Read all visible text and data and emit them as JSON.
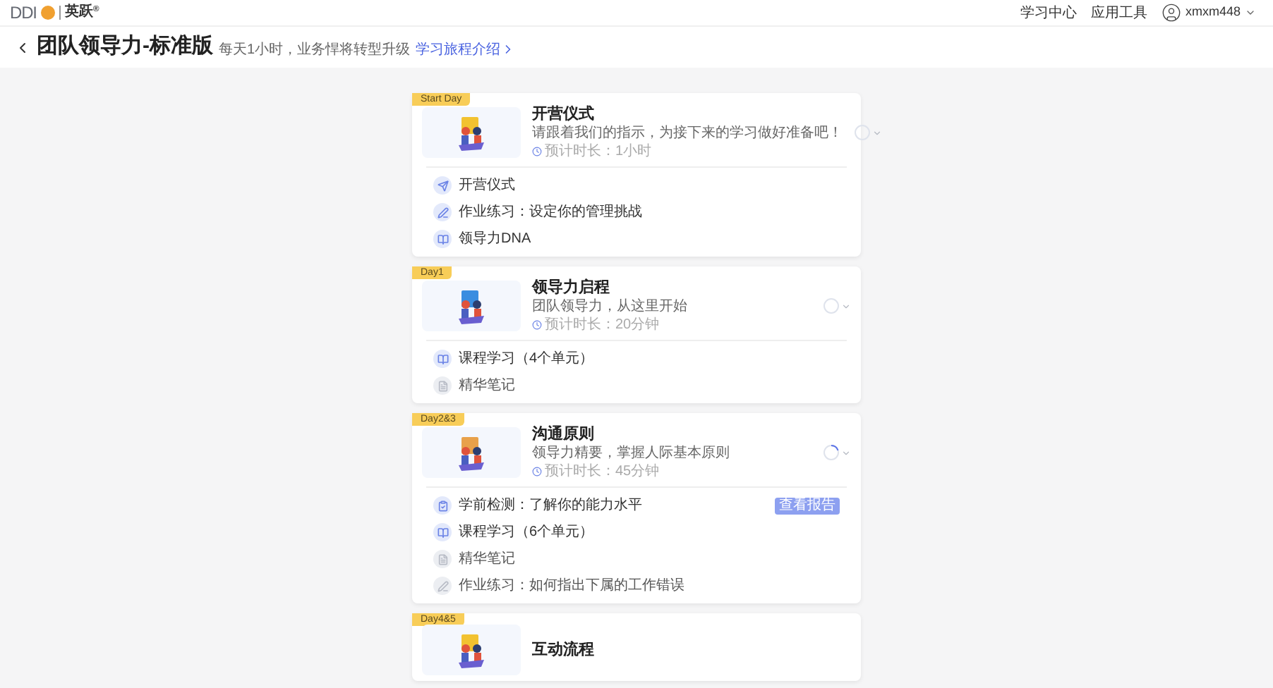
{
  "header": {
    "logo_text": "DDI",
    "brand": "英跃",
    "brand_mark": "®",
    "nav": [
      "学习中心",
      "应用工具"
    ],
    "user": "xmxm448"
  },
  "title_bar": {
    "title": "团队领导力-标准版",
    "subtitle": "每天1小时，业务悍将转型升级",
    "link": "学习旅程介绍"
  },
  "stages": [
    {
      "badge": "Start Day",
      "title": "开营仪式",
      "subtitle": "请跟着我们的指示，为接下来的学习做好准备吧！",
      "duration": "预计时长：1小时",
      "in_progress": false,
      "items": [
        {
          "kind": "launch",
          "label": "开营仪式",
          "locked": false
        },
        {
          "kind": "exercise",
          "label": "作业练习：设定你的管理挑战",
          "locked": false
        },
        {
          "kind": "course",
          "label": "领导力DNA",
          "locked": false
        }
      ]
    },
    {
      "badge": "Day1",
      "title": "领导力启程",
      "subtitle": "团队领导力，从这里开始",
      "duration": "预计时长：20分钟",
      "in_progress": false,
      "items": [
        {
          "kind": "course",
          "label": "课程学习（4个单元）",
          "locked": false
        },
        {
          "kind": "note",
          "label": "精华笔记",
          "locked": true
        }
      ]
    },
    {
      "badge": "Day2&3",
      "title": "沟通原则",
      "subtitle": "领导力精要，掌握人际基本原则",
      "duration": "预计时长：45分钟",
      "in_progress": true,
      "items": [
        {
          "kind": "test",
          "label": "学前检测：了解你的能力水平",
          "locked": false,
          "action": "查看报告"
        },
        {
          "kind": "course",
          "label": "课程学习（6个单元）",
          "locked": false
        },
        {
          "kind": "note",
          "label": "精华笔记",
          "locked": true
        },
        {
          "kind": "exercise",
          "label": "作业练习：如何指出下属的工作错误",
          "locked": true
        }
      ]
    },
    {
      "badge": "Day4&5",
      "title": "互动流程"
    }
  ]
}
